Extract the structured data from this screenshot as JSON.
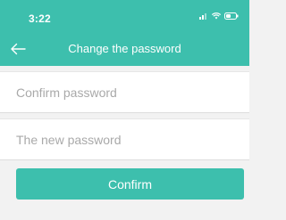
{
  "status_bar": {
    "time": "3:22",
    "icons": [
      "signal-icon",
      "wifi-icon",
      "battery-icon"
    ]
  },
  "header": {
    "title": "Change the password",
    "back_icon": "back-arrow-icon"
  },
  "form": {
    "confirm_password_placeholder": "Confirm password",
    "new_password_placeholder": "The new password",
    "confirm_password_value": "",
    "new_password_value": ""
  },
  "actions": {
    "confirm_label": "Confirm"
  },
  "colors": {
    "accent": "#3dbfad",
    "background": "#f2f2f2"
  }
}
